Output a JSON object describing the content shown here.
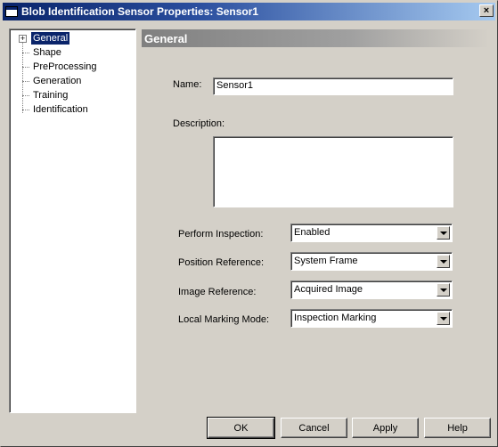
{
  "window": {
    "title": "Blob Identification Sensor Properties: Sensor1",
    "close_glyph": "×"
  },
  "tree": {
    "expander_glyph": "+",
    "items": [
      {
        "label": "General",
        "selected": true
      },
      {
        "label": "Shape"
      },
      {
        "label": "PreProcessing"
      },
      {
        "label": "Generation"
      },
      {
        "label": "Training"
      },
      {
        "label": "Identification"
      }
    ]
  },
  "panel": {
    "header": "General",
    "name_label": "Name:",
    "name_value": "Sensor1",
    "description_label": "Description:",
    "description_value": "",
    "fields": [
      {
        "label": "Perform Inspection:",
        "value": "Enabled"
      },
      {
        "label": "Position Reference:",
        "value": "System Frame"
      },
      {
        "label": "Image Reference:",
        "value": "Acquired Image"
      },
      {
        "label": "Local Marking Mode:",
        "value": "Inspection Marking"
      }
    ]
  },
  "buttons": {
    "ok": "OK",
    "cancel": "Cancel",
    "apply": "Apply",
    "help": "Help"
  }
}
